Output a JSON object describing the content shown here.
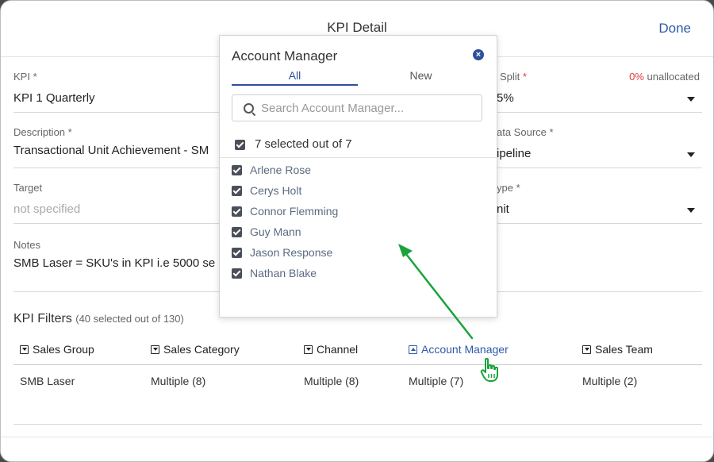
{
  "header": {
    "title": "KPI Detail",
    "done_label": "Done"
  },
  "form": {
    "kpi_label": "KPI",
    "kpi_value": "KPI 1 Quarterly",
    "description_label": "Description",
    "description_value": "Transactional Unit Achievement - SM",
    "target_label": "Target",
    "target_placeholder": "not specified",
    "notes_label": "Notes",
    "notes_value": "SMB Laser = SKU's in KPI i.e 5000 se",
    "split_label": "Split",
    "split_value": "5%",
    "unallocated_pct": "0%",
    "unallocated_text": "unallocated",
    "data_source_label": "ata Source",
    "data_source_value": "ipeline",
    "type_label": "ype",
    "type_value": "nit",
    "required_mark": "*"
  },
  "filters": {
    "title": "KPI Filters",
    "summary": "(40 selected out of 130)",
    "columns": [
      "Sales Group",
      "Sales Category",
      "Channel",
      "Account Manager",
      "Sales Team"
    ],
    "values": [
      "SMB Laser",
      "Multiple (8)",
      "Multiple (8)",
      "Multiple (7)",
      "Multiple (2)"
    ],
    "active_column": "Account Manager"
  },
  "popover": {
    "title": "Account Manager",
    "tabs": [
      "All",
      "New"
    ],
    "active_tab": "All",
    "search_placeholder": "Search Account Manager...",
    "selected_summary": "7 selected out of 7",
    "items": [
      "Arlene Rose",
      "Cerys Holt",
      "Connor Flemming",
      "Guy Mann",
      "Jason Response",
      "Nathan Blake"
    ]
  },
  "colors": {
    "accent": "#2d4f9c",
    "required": "#e03b3b",
    "annotation_arrow": "#1aa33a"
  },
  "icons": {
    "close": "close-circle-icon",
    "search": "search-icon",
    "filter_toggle": "dropdown-square-icon",
    "cursor": "hand-pointer-icon"
  }
}
